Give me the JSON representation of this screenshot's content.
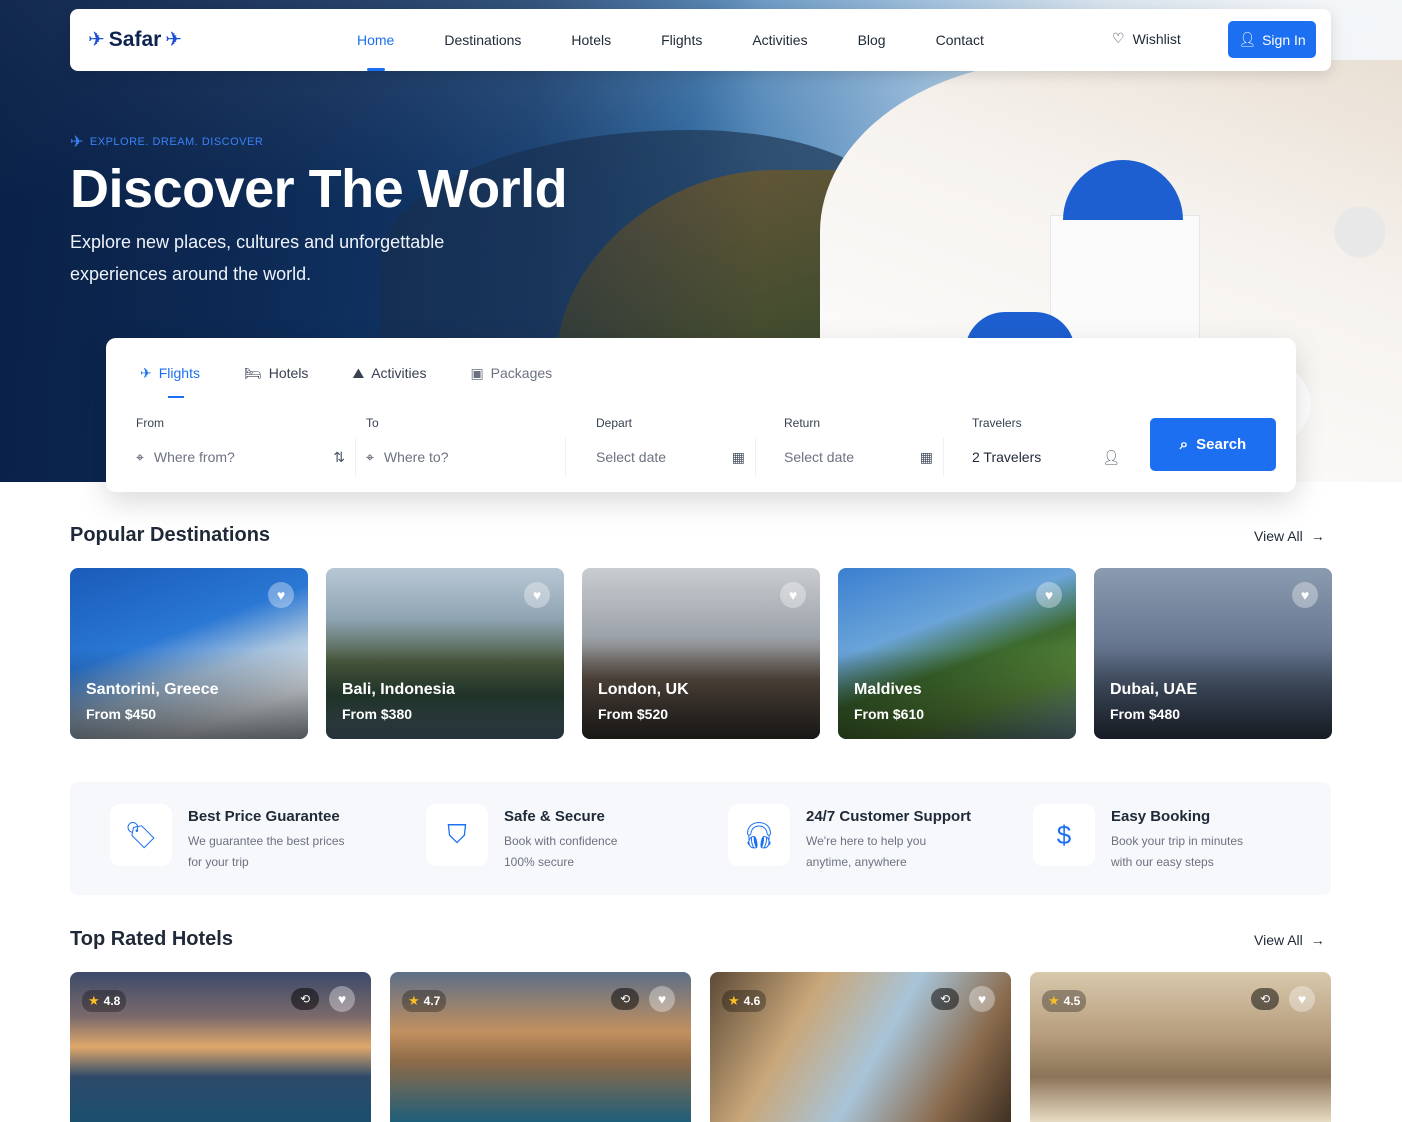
{
  "brand": {
    "name": "Safar"
  },
  "nav": {
    "links": [
      "Home",
      "Destinations",
      "Hotels",
      "Flights",
      "Activities",
      "Blog",
      "Contact"
    ],
    "active": "Home",
    "wishlist": "Wishlist",
    "signin": "Sign In"
  },
  "hero": {
    "eyebrow": "EXPLORE. DREAM. DISCOVER",
    "title": "Discover The World",
    "subtitle": "Explore new places, cultures and unforgettable experiences around the world."
  },
  "search": {
    "tabs": [
      "Flights",
      "Hotels",
      "Activities",
      "Packages"
    ],
    "active_tab": "Flights",
    "from": {
      "label": "From",
      "placeholder": "Where from?"
    },
    "to": {
      "label": "To",
      "placeholder": "Where to?"
    },
    "depart": {
      "label": "Depart",
      "placeholder": "Select date"
    },
    "return": {
      "label": "Return",
      "placeholder": "Select date"
    },
    "travelers": {
      "label": "Travelers",
      "value": "2 Travelers"
    },
    "button": "Search"
  },
  "destinations": {
    "title": "Popular Destinations",
    "view_all": "View All",
    "items": [
      {
        "name": "Santorini, Greece",
        "price": "From $450"
      },
      {
        "name": "Bali, Indonesia",
        "price": "From $380"
      },
      {
        "name": "London, UK",
        "price": "From $520"
      },
      {
        "name": "Maldives",
        "price": "From $610"
      },
      {
        "name": "Dubai, UAE",
        "price": "From $480"
      }
    ]
  },
  "features": [
    {
      "title": "Best Price Guarantee",
      "desc": "We guarantee the best prices for your trip",
      "icon": "price-tag-icon"
    },
    {
      "title": "Safe & Secure",
      "desc": "Book with confidence 100% secure",
      "icon": "shield-icon"
    },
    {
      "title": "24/7 Customer Support",
      "desc": "We're here to help you anytime, anywhere",
      "icon": "headset-icon"
    },
    {
      "title": "Easy Booking",
      "desc": "Book your trip in minutes with our easy steps",
      "icon": "dollar-icon"
    }
  ],
  "hotels": {
    "title": "Top Rated Hotels",
    "view_all": "View All",
    "items": [
      {
        "rating": "4.8"
      },
      {
        "rating": "4.7"
      },
      {
        "rating": "4.6"
      },
      {
        "rating": "4.5"
      }
    ]
  },
  "colors": {
    "accent": "#1d6ff2",
    "brand_dark": "#0f2350"
  }
}
